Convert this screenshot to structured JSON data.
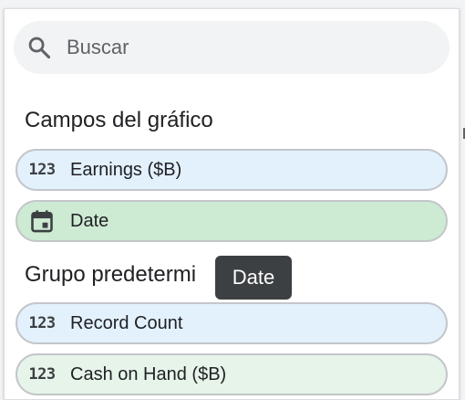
{
  "search": {
    "placeholder": "Buscar",
    "icon": "search-icon"
  },
  "sections": [
    {
      "title": "Campos del gráfico",
      "fields": [
        {
          "label": "Earnings ($B)",
          "type": "metric",
          "icon": "number-123-icon",
          "icon_text": "123",
          "color": "#e3f1fd"
        },
        {
          "label": "Date",
          "type": "dimension",
          "icon": "calendar-icon",
          "color": "#cdebd2"
        }
      ]
    },
    {
      "title": "Grupo predetermi",
      "fields": [
        {
          "label": "Record Count",
          "type": "metric",
          "icon": "number-123-icon",
          "icon_text": "123",
          "color": "#e3f1fd"
        },
        {
          "label": "Cash on Hand ($B)",
          "type": "metric",
          "icon": "number-123-icon",
          "icon_text": "123",
          "color": "#e6f4ea"
        }
      ]
    }
  ],
  "tooltip": {
    "text": "Date"
  }
}
